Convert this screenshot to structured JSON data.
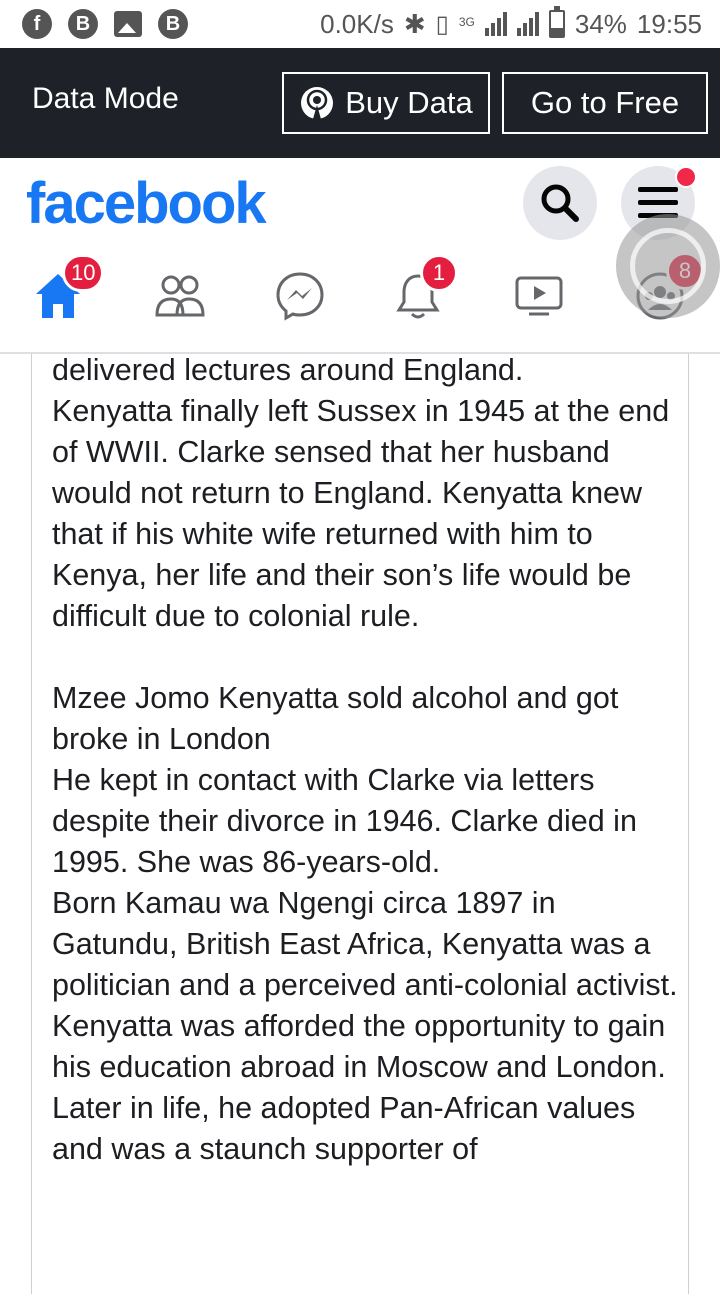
{
  "status_bar": {
    "left_icons": [
      "facebook-icon",
      "b-app-icon",
      "image-icon",
      "b-app-icon"
    ],
    "speed": "0.0K/s",
    "network": "3G",
    "battery": "34%",
    "battery_level": 0.34,
    "time": "19:55"
  },
  "data_mode": {
    "title": "Data Mode",
    "buy_data_label": "Buy Data",
    "go_free_label": "Go to Free"
  },
  "header": {
    "logo": "facebook",
    "search_icon": "search-icon",
    "menu_icon": "menu-icon"
  },
  "nav": {
    "home_badge": "10",
    "notifications_badge": "1",
    "groups_badge": "8"
  },
  "article": {
    "text": "delivered lectures around England.\nKenyatta finally left Sussex in 1945 at the end of WWII. Clarke sensed that her husband would not return to England. Kenyatta knew that if his white wife returned with him to Kenya, her life and their son’s life would be difficult due to colonial rule.\n\nMzee Jomo Kenyatta sold alcohol and got broke in London\nHe kept in contact with Clarke via letters despite their divorce in 1946. Clarke died in 1995. She was 86-years-old.\nBorn Kamau wa Ngengi circa 1897 in Gatundu, British East Africa, Kenyatta was a politician and a perceived anti-colonial activist.\nKenyatta was afforded the opportunity to gain his education abroad in Moscow and London.\nLater in life, he adopted Pan-African values and was a staunch supporter of"
  },
  "colors": {
    "brand": "#1877f2",
    "data_bar": "#1e2228",
    "badge": "#e41e3f"
  }
}
